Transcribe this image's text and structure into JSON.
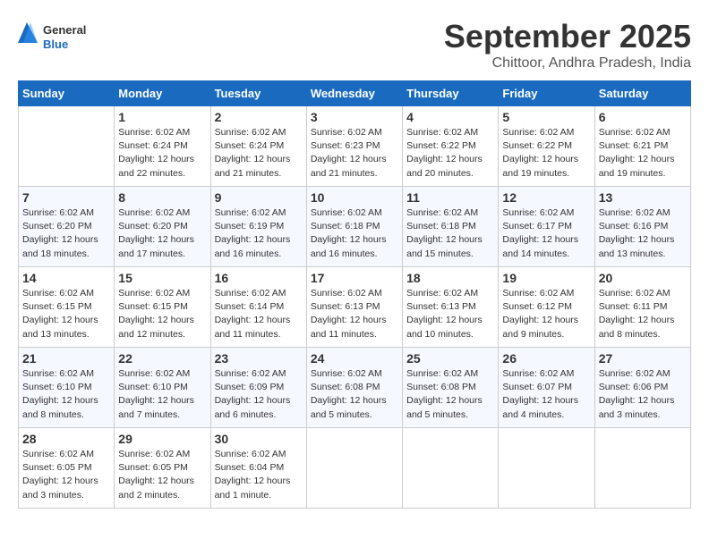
{
  "header": {
    "logo_general": "General",
    "logo_blue": "Blue",
    "month_title": "September 2025",
    "subtitle": "Chittoor, Andhra Pradesh, India"
  },
  "weekdays": [
    "Sunday",
    "Monday",
    "Tuesday",
    "Wednesday",
    "Thursday",
    "Friday",
    "Saturday"
  ],
  "weeks": [
    [
      {
        "day": "",
        "info": ""
      },
      {
        "day": "1",
        "info": "Sunrise: 6:02 AM\nSunset: 6:24 PM\nDaylight: 12 hours\nand 22 minutes."
      },
      {
        "day": "2",
        "info": "Sunrise: 6:02 AM\nSunset: 6:24 PM\nDaylight: 12 hours\nand 21 minutes."
      },
      {
        "day": "3",
        "info": "Sunrise: 6:02 AM\nSunset: 6:23 PM\nDaylight: 12 hours\nand 21 minutes."
      },
      {
        "day": "4",
        "info": "Sunrise: 6:02 AM\nSunset: 6:22 PM\nDaylight: 12 hours\nand 20 minutes."
      },
      {
        "day": "5",
        "info": "Sunrise: 6:02 AM\nSunset: 6:22 PM\nDaylight: 12 hours\nand 19 minutes."
      },
      {
        "day": "6",
        "info": "Sunrise: 6:02 AM\nSunset: 6:21 PM\nDaylight: 12 hours\nand 19 minutes."
      }
    ],
    [
      {
        "day": "7",
        "info": "Sunrise: 6:02 AM\nSunset: 6:20 PM\nDaylight: 12 hours\nand 18 minutes."
      },
      {
        "day": "8",
        "info": "Sunrise: 6:02 AM\nSunset: 6:20 PM\nDaylight: 12 hours\nand 17 minutes."
      },
      {
        "day": "9",
        "info": "Sunrise: 6:02 AM\nSunset: 6:19 PM\nDaylight: 12 hours\nand 16 minutes."
      },
      {
        "day": "10",
        "info": "Sunrise: 6:02 AM\nSunset: 6:18 PM\nDaylight: 12 hours\nand 16 minutes."
      },
      {
        "day": "11",
        "info": "Sunrise: 6:02 AM\nSunset: 6:18 PM\nDaylight: 12 hours\nand 15 minutes."
      },
      {
        "day": "12",
        "info": "Sunrise: 6:02 AM\nSunset: 6:17 PM\nDaylight: 12 hours\nand 14 minutes."
      },
      {
        "day": "13",
        "info": "Sunrise: 6:02 AM\nSunset: 6:16 PM\nDaylight: 12 hours\nand 13 minutes."
      }
    ],
    [
      {
        "day": "14",
        "info": "Sunrise: 6:02 AM\nSunset: 6:15 PM\nDaylight: 12 hours\nand 13 minutes."
      },
      {
        "day": "15",
        "info": "Sunrise: 6:02 AM\nSunset: 6:15 PM\nDaylight: 12 hours\nand 12 minutes."
      },
      {
        "day": "16",
        "info": "Sunrise: 6:02 AM\nSunset: 6:14 PM\nDaylight: 12 hours\nand 11 minutes."
      },
      {
        "day": "17",
        "info": "Sunrise: 6:02 AM\nSunset: 6:13 PM\nDaylight: 12 hours\nand 11 minutes."
      },
      {
        "day": "18",
        "info": "Sunrise: 6:02 AM\nSunset: 6:13 PM\nDaylight: 12 hours\nand 10 minutes."
      },
      {
        "day": "19",
        "info": "Sunrise: 6:02 AM\nSunset: 6:12 PM\nDaylight: 12 hours\nand 9 minutes."
      },
      {
        "day": "20",
        "info": "Sunrise: 6:02 AM\nSunset: 6:11 PM\nDaylight: 12 hours\nand 8 minutes."
      }
    ],
    [
      {
        "day": "21",
        "info": "Sunrise: 6:02 AM\nSunset: 6:10 PM\nDaylight: 12 hours\nand 8 minutes."
      },
      {
        "day": "22",
        "info": "Sunrise: 6:02 AM\nSunset: 6:10 PM\nDaylight: 12 hours\nand 7 minutes."
      },
      {
        "day": "23",
        "info": "Sunrise: 6:02 AM\nSunset: 6:09 PM\nDaylight: 12 hours\nand 6 minutes."
      },
      {
        "day": "24",
        "info": "Sunrise: 6:02 AM\nSunset: 6:08 PM\nDaylight: 12 hours\nand 5 minutes."
      },
      {
        "day": "25",
        "info": "Sunrise: 6:02 AM\nSunset: 6:08 PM\nDaylight: 12 hours\nand 5 minutes."
      },
      {
        "day": "26",
        "info": "Sunrise: 6:02 AM\nSunset: 6:07 PM\nDaylight: 12 hours\nand 4 minutes."
      },
      {
        "day": "27",
        "info": "Sunrise: 6:02 AM\nSunset: 6:06 PM\nDaylight: 12 hours\nand 3 minutes."
      }
    ],
    [
      {
        "day": "28",
        "info": "Sunrise: 6:02 AM\nSunset: 6:05 PM\nDaylight: 12 hours\nand 3 minutes."
      },
      {
        "day": "29",
        "info": "Sunrise: 6:02 AM\nSunset: 6:05 PM\nDaylight: 12 hours\nand 2 minutes."
      },
      {
        "day": "30",
        "info": "Sunrise: 6:02 AM\nSunset: 6:04 PM\nDaylight: 12 hours\nand 1 minute."
      },
      {
        "day": "",
        "info": ""
      },
      {
        "day": "",
        "info": ""
      },
      {
        "day": "",
        "info": ""
      },
      {
        "day": "",
        "info": ""
      }
    ]
  ]
}
